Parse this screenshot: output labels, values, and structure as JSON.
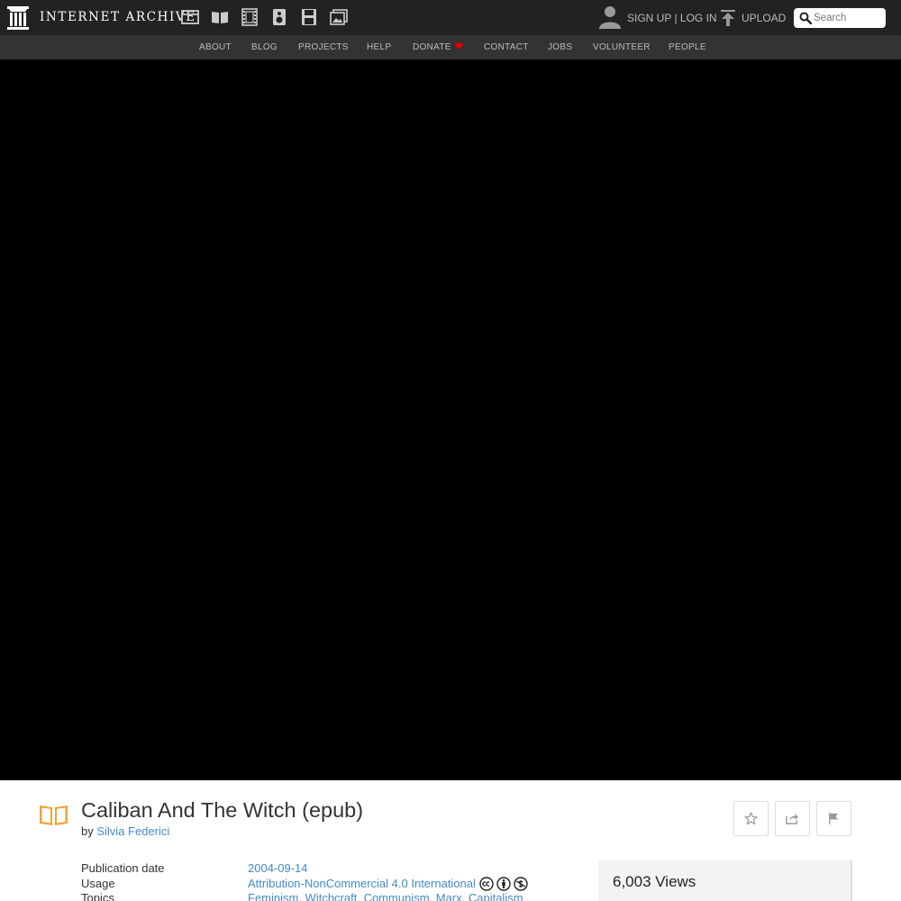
{
  "header": {
    "logo_text": "INTERNET ARCHIVE",
    "media_icons": [
      "web-icon",
      "texts-icon",
      "video-icon",
      "audio-icon",
      "software-icon",
      "images-icon"
    ],
    "sign_up": "SIGN UP",
    "separator": " | ",
    "log_in": "LOG IN",
    "upload": "UPLOAD",
    "search_placeholder": "Search"
  },
  "nav": {
    "items": [
      "ABOUT",
      "BLOG",
      "PROJECTS",
      "HELP",
      "DONATE",
      "CONTACT",
      "JOBS",
      "VOLUNTEER",
      "PEOPLE"
    ]
  },
  "item": {
    "title": "Caliban And The Witch (epub)",
    "by_prefix": "by ",
    "author": "Silvia Federici",
    "actions": [
      "favorite-icon",
      "share-icon",
      "flag-icon"
    ]
  },
  "metadata": [
    {
      "key": "Publication date",
      "value": "2004-09-14"
    },
    {
      "key": "Usage",
      "value": "Attribution-NonCommercial 4.0 International"
    },
    {
      "key": "Topics",
      "value": "Feminism, Witchcraft, Communism, Marx, Capitalism"
    }
  ],
  "license_icons": [
    "cc-icon",
    "by-icon",
    "nc-icon"
  ],
  "stats": {
    "views": "6,003 Views"
  },
  "colors": {
    "topbar": "#222222",
    "navbar": "#333333",
    "link": "#428bca",
    "book_icon": "#f4a236",
    "heart": "#e00000"
  }
}
